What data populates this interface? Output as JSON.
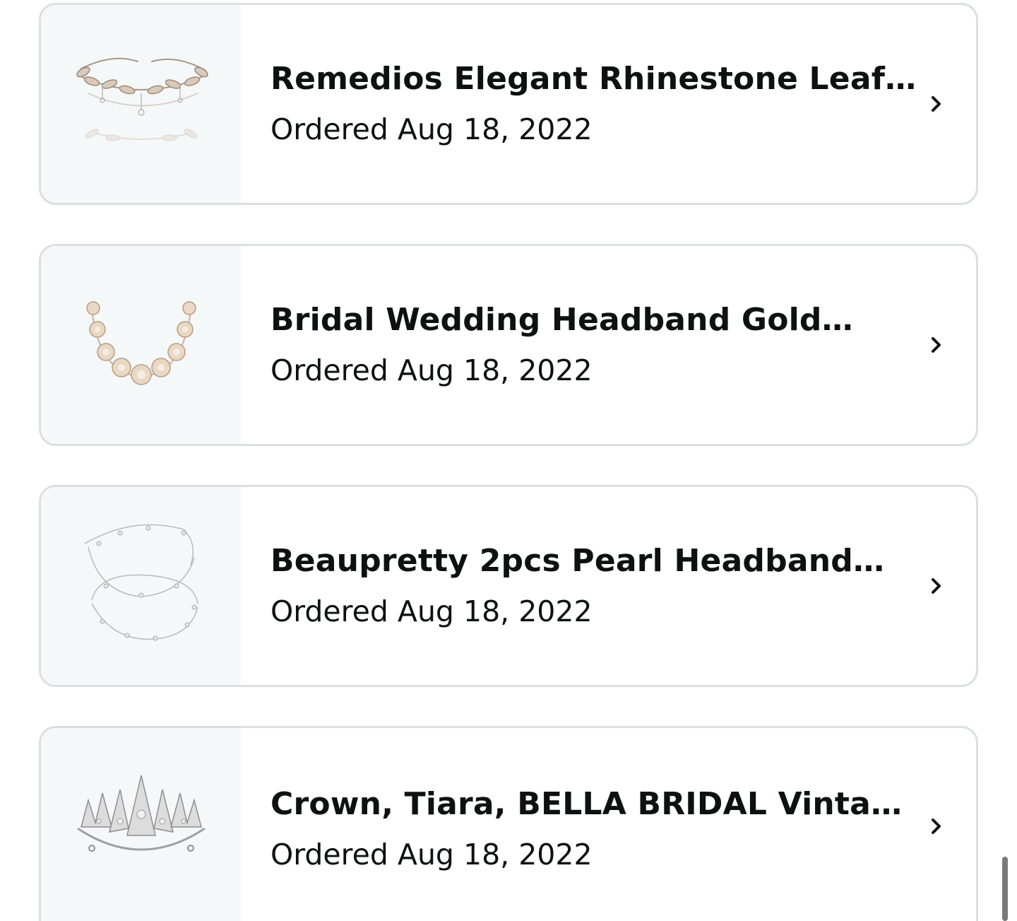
{
  "orders": [
    {
      "title": "Remedios Elegant Rhinestone Leaf…",
      "date": "Ordered Aug 18, 2022",
      "image_icon": "leaf-headband-image"
    },
    {
      "title": "Bridal Wedding Headband Gold…",
      "date": "Ordered Aug 18, 2022",
      "image_icon": "flower-headband-image"
    },
    {
      "title": "Beaupretty 2pcs Pearl Headband…",
      "date": "Ordered Aug 18, 2022",
      "image_icon": "pearl-headband-image"
    },
    {
      "title": "Crown, Tiara, BELLA BRIDAL Vinta…",
      "date": "Ordered Aug 18, 2022",
      "image_icon": "tiara-image"
    }
  ],
  "colors": {
    "card_border": "#dcdfe0",
    "thumb_background": "#f5f8f9",
    "text": "#0f1111"
  }
}
